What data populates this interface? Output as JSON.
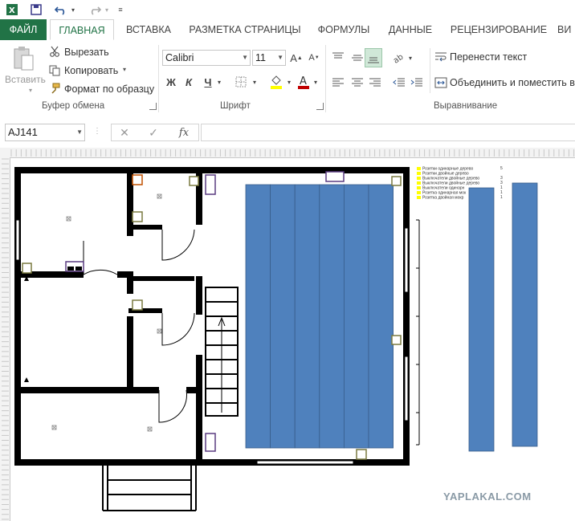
{
  "quick_access": {
    "app_icon": "excel-logo-icon",
    "save_icon": "save-icon",
    "undo_icon": "undo-icon",
    "redo_icon": "redo-icon",
    "customize_icon": "customize-qat-icon"
  },
  "tabs": [
    {
      "label": "ФАЙЛ"
    },
    {
      "label": "ГЛАВНАЯ"
    },
    {
      "label": "ВСТАВКА"
    },
    {
      "label": "РАЗМЕТКА СТРАНИЦЫ"
    },
    {
      "label": "ФОРМУЛЫ"
    },
    {
      "label": "ДАННЫЕ"
    },
    {
      "label": "РЕЦЕНЗИРОВАНИЕ"
    },
    {
      "label": "ВИ"
    }
  ],
  "clipboard": {
    "paste_label": "Вставить",
    "cut_label": "Вырезать",
    "copy_label": "Копировать",
    "format_painter_label": "Формат по образцу",
    "group_label": "Буфер обмена"
  },
  "font": {
    "family": "Calibri",
    "size": "11",
    "bold": "Ж",
    "italic": "К",
    "underline": "Ч",
    "group_label": "Шрифт",
    "fill_color": "#ffff00",
    "font_color": "#c00000"
  },
  "alignment": {
    "wrap_text_label": "Перенести текст",
    "merge_label": "Объединить и поместить в ц",
    "group_label": "Выравнивание"
  },
  "formula_bar": {
    "name_box": "AJ141",
    "fx": "fx",
    "cancel_icon": "cancel-icon",
    "enter_icon": "check-icon",
    "formula": ""
  },
  "legend": {
    "items": [
      {
        "label": "Розетки одинарные дерево",
        "count": "5",
        "color": "#ffff00"
      },
      {
        "label": "Розетки двойные дерево",
        "count": "",
        "color": "#ffff00"
      },
      {
        "label": "Выключатели двойные дерево",
        "count": "3",
        "color": "#ffff00"
      },
      {
        "label": "Выключатели двойные дерево",
        "count": "3",
        "color": "#ffff00"
      },
      {
        "label": "Выключатели одинарн",
        "count": "1",
        "color": "#ffff00"
      },
      {
        "label": "Розетка одинарная мок",
        "count": "1",
        "color": "#ffff00"
      },
      {
        "label": "Розетка двойная мокр",
        "count": "1",
        "color": "#ffff00"
      }
    ]
  },
  "colors": {
    "accent": "#217346",
    "shape_blue": "#4f81bd",
    "wall": "#000000"
  },
  "watermark": "YAPLAKAL.COM"
}
